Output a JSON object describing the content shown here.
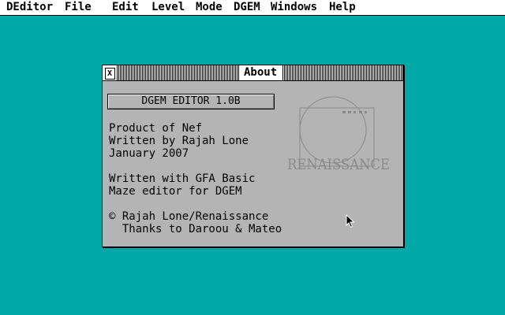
{
  "menubar": {
    "items": [
      "DEditor",
      "File",
      "Edit",
      "Level",
      "Mode",
      "DGEM",
      "Windows",
      "Help"
    ]
  },
  "about_window": {
    "title": "About",
    "close_glyph": "X",
    "app_name": "DGEM EDITOR 1.0B",
    "lines": [
      "Product of Nef",
      "Written by Rajah Lone",
      "January 2007",
      "Written with GFA Basic",
      "Maze editor for DGEM",
      "© Rajah Lone/Renaissance",
      "  Thanks to Daroou & Mateo"
    ],
    "logo_text": "RENAISSANCE"
  },
  "colors": {
    "desktop": "#00a8a8",
    "window": "#b4b4b4",
    "logo": "#8a8a8a"
  },
  "icons": {
    "close": "close-icon",
    "cursor": "mouse-pointer-icon",
    "logo": "renaissance-logo"
  }
}
